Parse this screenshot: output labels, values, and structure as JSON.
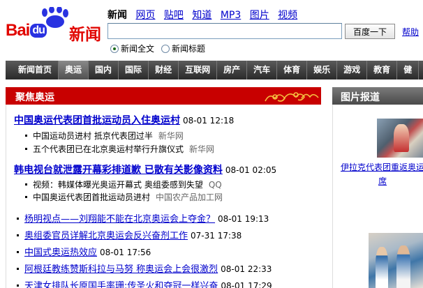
{
  "logo": {
    "brand_text": "Bai",
    "brand_du": "du",
    "brand_news": "新闻"
  },
  "nav": {
    "items": [
      {
        "label": "新闻",
        "active": true
      },
      {
        "label": "网页",
        "active": false
      },
      {
        "label": "贴吧",
        "active": false
      },
      {
        "label": "知道",
        "active": false
      },
      {
        "label": "MP3",
        "active": false
      },
      {
        "label": "图片",
        "active": false
      },
      {
        "label": "视频",
        "active": false
      }
    ]
  },
  "search": {
    "value": "",
    "button_label": "百度一下",
    "help_label": "帮助"
  },
  "search_options": [
    {
      "label": "新闻全文",
      "checked": true
    },
    {
      "label": "新闻标题",
      "checked": false
    }
  ],
  "channels": [
    "新闻首页",
    "奥运",
    "国内",
    "国际",
    "财经",
    "互联网",
    "房产",
    "汽车",
    "体育",
    "娱乐",
    "游戏",
    "教育",
    "健"
  ],
  "focus": {
    "title": "聚焦奥运",
    "headlines": [
      {
        "title": "中国奥运代表团首批运动员入住奥运村",
        "time": "08-01 12:18",
        "subs": [
          {
            "text": "中国运动员进村 抵京代表团过半",
            "source": "新华网"
          },
          {
            "text": "五个代表团已在北京奥运村举行升旗仪式",
            "source": "新华网"
          }
        ]
      },
      {
        "title": "韩电视台就泄露开幕彩排道歉 已散有关影像资料",
        "time": "08-01 02:05",
        "subs": [
          {
            "text": "视频：韩媒体曝光奥运开幕式 奥组委感到失望",
            "source": "QQ"
          },
          {
            "text": "中国奥运代表团首批运动员进村",
            "source": "中国农产品加工网"
          }
        ]
      }
    ],
    "items": [
      {
        "title": "杨明视点——刘翔能不能在北京奥运会上夺金？",
        "time": "08-01 19:13"
      },
      {
        "title": "奥组委官员详解北京奥运会反兴奋剂工作",
        "time": "07-31 17:38"
      },
      {
        "title": "中国式奥运热效应",
        "time": "08-01 17:56"
      },
      {
        "title": "阿根廷教练赞斯科拉与马努 称奥运会上会很激烈",
        "time": "08-01 22:33"
      },
      {
        "title": "天津女排队长原国手率珊:传圣火和夺冠一样兴奋",
        "time": "08-01 17:29"
      }
    ]
  },
  "photos": {
    "title": "图片报道",
    "caption": "伊拉克代表团重返奥运席"
  },
  "colors": {
    "accent_red": "#c80000",
    "link_blue": "#0000cc",
    "bar_dark": "#333333"
  }
}
